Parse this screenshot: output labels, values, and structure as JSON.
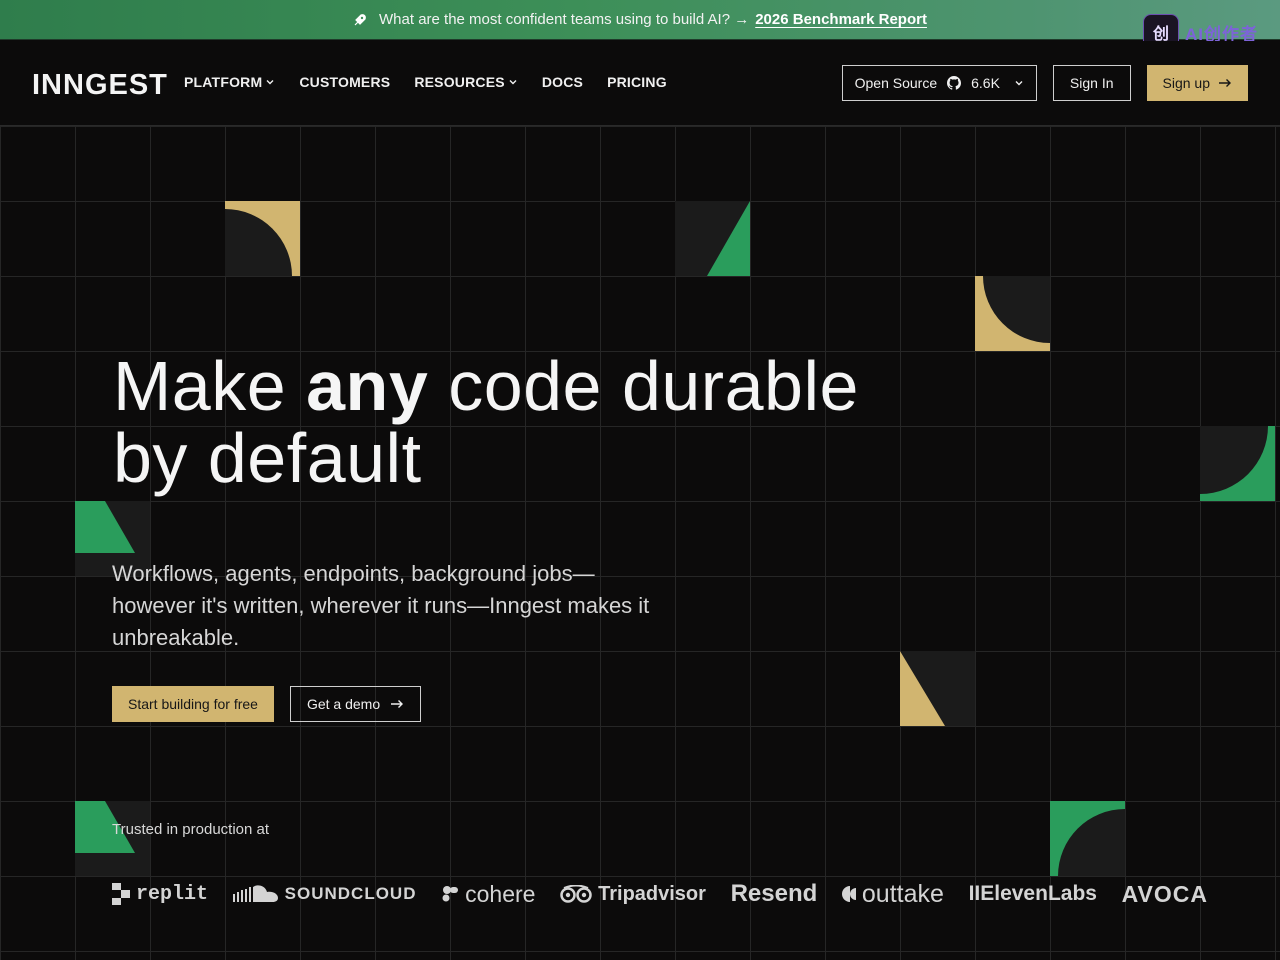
{
  "banner": {
    "message": "What are the most confident teams using to build AI? →",
    "link_text": "2026 Benchmark Report"
  },
  "watermark": {
    "badge": "创",
    "text": "AI创作者"
  },
  "nav": {
    "logo": "INNGEST",
    "links": [
      {
        "label": "PLATFORM",
        "dropdown": true
      },
      {
        "label": "CUSTOMERS",
        "dropdown": false
      },
      {
        "label": "RESOURCES",
        "dropdown": true
      },
      {
        "label": "DOCS",
        "dropdown": false
      },
      {
        "label": "PRICING",
        "dropdown": false
      }
    ],
    "open_source_label": "Open Source",
    "github_stars": "6.6K",
    "sign_in": "Sign In",
    "sign_up": "Sign up"
  },
  "hero": {
    "title_part1": "Make ",
    "title_bold": "any",
    "title_part2": " code durable",
    "title_line2": "by default",
    "subtitle": "Workflows, agents, endpoints, background jobs—however it's written, wherever it runs—Inngest makes it unbreakable.",
    "primary_cta": "Start building for free",
    "secondary_cta": "Get a demo"
  },
  "trusted": {
    "label": "Trusted in production at",
    "logos": [
      "replit",
      "SOUNDCLOUD",
      "cohere",
      "Tripadvisor",
      "Resend",
      "outtake",
      "IIElevenLabs",
      "AVOCA"
    ]
  },
  "colors": {
    "gold": "#d1b570",
    "green": "#2a9d5c",
    "background": "#0c0b0b",
    "tile_dark": "#1b1b1b"
  }
}
